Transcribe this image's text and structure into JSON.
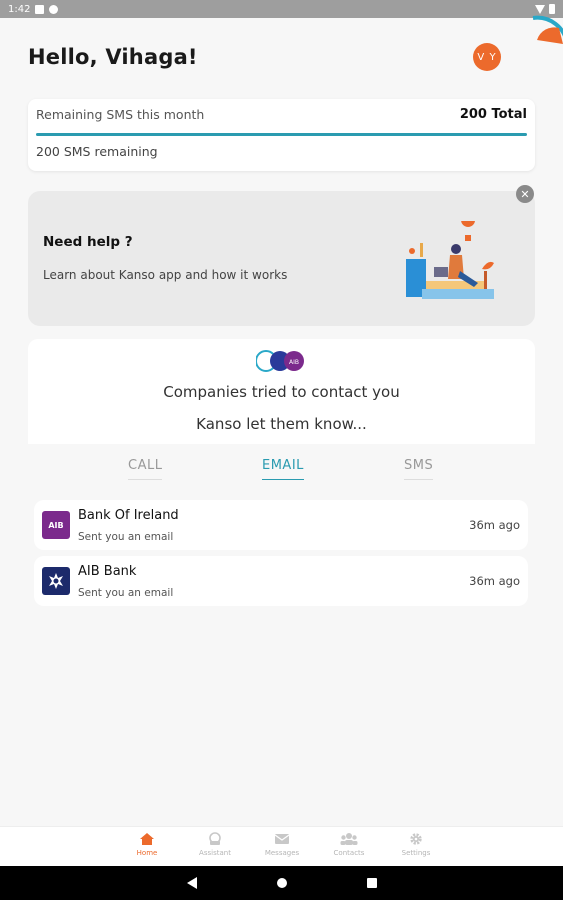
{
  "status_bar": {
    "time": "1:42"
  },
  "header": {
    "greeting": "Hello, Vihaga!",
    "avatar_initials": "V Y"
  },
  "sms": {
    "label": "Remaining SMS this month",
    "total": "200 Total",
    "remaining": "200 SMS remaining",
    "used_fraction": 1.0
  },
  "help": {
    "title": "Need help ?",
    "subtitle": "Learn about Kanso app and how it works",
    "close_symbol": "✕"
  },
  "contact": {
    "title": "Companies tried to contact you",
    "subtitle": "Kanso let them know..."
  },
  "tabs": [
    {
      "label": "CALL",
      "active": false
    },
    {
      "label": "EMAIL",
      "active": true
    },
    {
      "label": "SMS",
      "active": false
    }
  ],
  "messages": [
    {
      "name": "Bank Of Ireland",
      "sub": "Sent you an email",
      "time": "36m ago",
      "icon_text": "AIB",
      "icon_color": "#7b2a8c",
      "icon": "aib-logo-icon"
    },
    {
      "name": "AIB Bank",
      "sub": "Sent you an email",
      "time": "36m ago",
      "icon_text": "",
      "icon_color": "#1c2a6b",
      "icon": "bank-of-ireland-logo-icon"
    }
  ],
  "nav": [
    {
      "label": "Home",
      "icon": "home-icon",
      "active": true
    },
    {
      "label": "Assistant",
      "icon": "assistant-icon",
      "active": false
    },
    {
      "label": "Messages",
      "icon": "mail-icon",
      "active": false
    },
    {
      "label": "Contacts",
      "icon": "contacts-icon",
      "active": false
    },
    {
      "label": "Settings",
      "icon": "gear-icon",
      "active": false
    }
  ],
  "colors": {
    "accent": "#2a9bb0",
    "brand_orange": "#ec6a2c",
    "inactive": "#b5b5b5"
  }
}
